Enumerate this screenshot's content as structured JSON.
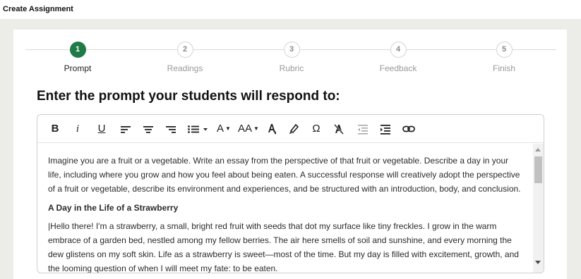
{
  "app": {
    "title": "Create Assignment"
  },
  "stepper": {
    "steps": [
      {
        "number": "1",
        "label": "Prompt",
        "active": true
      },
      {
        "number": "2",
        "label": "Readings",
        "active": false
      },
      {
        "number": "3",
        "label": "Rubric",
        "active": false
      },
      {
        "number": "4",
        "label": "Feedback",
        "active": false
      },
      {
        "number": "5",
        "label": "Finish",
        "active": false
      }
    ],
    "active_color": "#1e7a46"
  },
  "main": {
    "heading": "Enter the prompt your students will respond to:"
  },
  "editor": {
    "toolbar": {
      "bold_label": "B",
      "italic_label": "i",
      "underline_label": "U",
      "font_color_label": "A",
      "font_size_label": "AA",
      "special_char_label": "Ω",
      "icons": [
        "bold-icon",
        "italic-icon",
        "underline-icon",
        "align-left-icon",
        "align-center-icon",
        "align-right-icon",
        "bullet-list-icon",
        "font-color-icon",
        "font-size-icon",
        "fill-color-icon",
        "highlighter-icon",
        "special-character-icon",
        "clear-format-icon",
        "outdent-icon",
        "indent-icon",
        "link-icon"
      ]
    },
    "content": {
      "prompt": "Imagine you are a fruit or a vegetable. Write an essay from the perspective of that fruit or vegetable. Describe a day in your life, including where you grow and how you feel about being eaten. A successful response will creatively adopt the perspective of a fruit or vegetable, describe its environment and experiences, and be structured with an introduction, body, and conclusion.",
      "essay_title": "A Day in the Life of a Strawberry",
      "essay_paragraph": "|Hello there! I'm a strawberry, a small, bright red fruit with seeds that dot my surface like tiny freckles. I grow in the warm embrace of a garden bed, nestled among my fellow berries. The air here smells of soil and sunshine, and every morning the dew glistens on my soft skin. Life as a strawberry is sweet—most of the time. But my day is filled with excitement, growth, and the looming question of when I will meet my fate: to be eaten."
    }
  }
}
